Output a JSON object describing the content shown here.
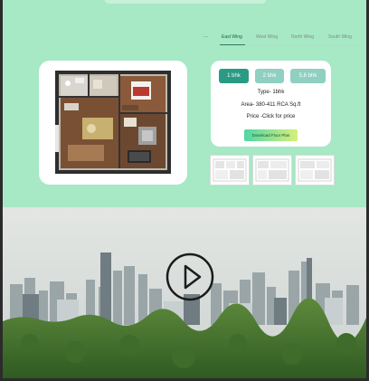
{
  "tabs": [
    {
      "label": "East Wing",
      "active": true
    },
    {
      "label": "West Wing",
      "active": false
    },
    {
      "label": "North Wing",
      "active": false
    },
    {
      "label": "South Wing",
      "active": false
    }
  ],
  "bhk_buttons": [
    "1 bhk",
    "2 bhk",
    "5,6 bhk"
  ],
  "details": {
    "type": "Type- 1bhk",
    "area": "Area- 380-411 RCA Sq.ft",
    "price": "Price -Click for price"
  },
  "download_label": "Download Floor Plan",
  "icons": {
    "play": "play-icon"
  },
  "colors": {
    "page_bg": "#a7e8c5",
    "accent": "#2a9a84",
    "inactive_btn": "#8fd0c2"
  }
}
